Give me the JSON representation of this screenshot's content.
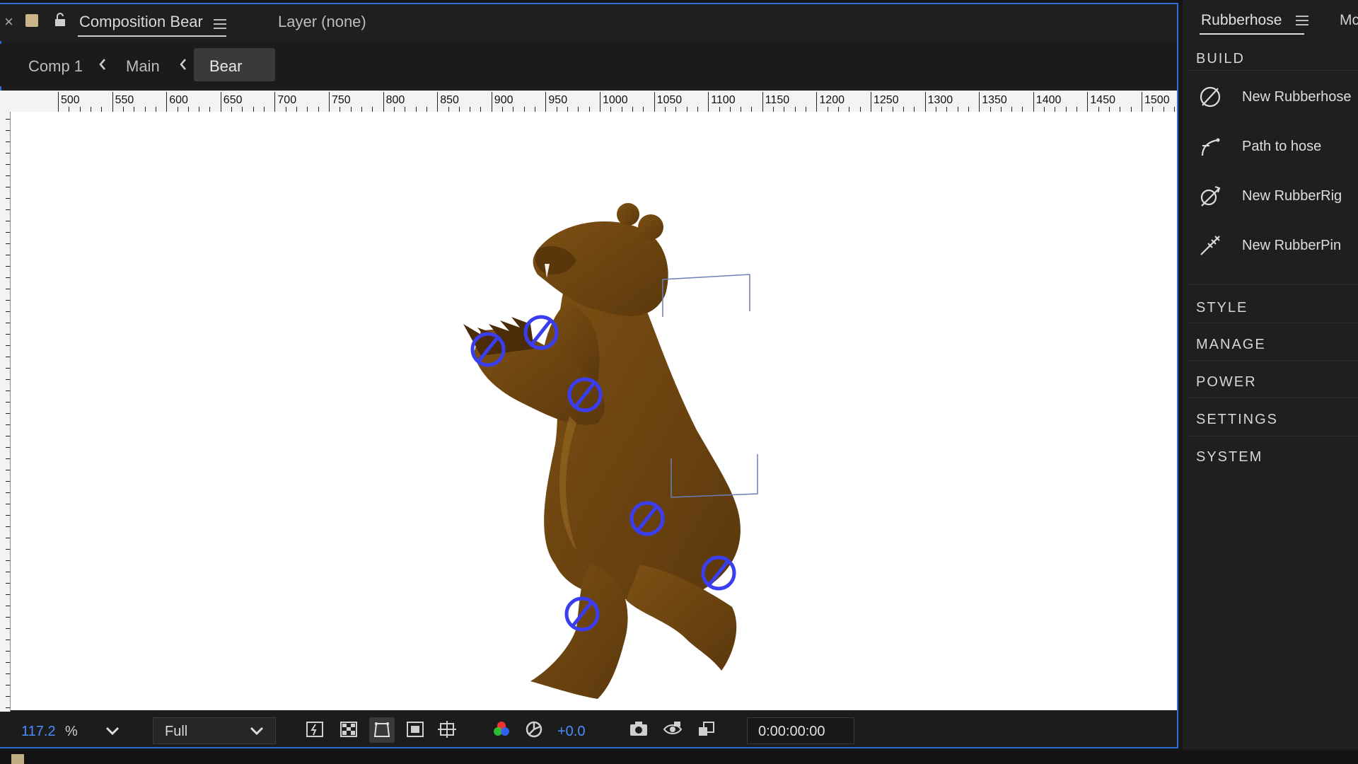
{
  "tabs": {
    "close_glyph": "×",
    "composition_tab": "Composition Bear",
    "layer_tab": "Layer (none)"
  },
  "breadcrumbs": [
    "Comp 1",
    "Main",
    "Bear"
  ],
  "ruler": {
    "labels": [
      "500",
      "550",
      "600",
      "650",
      "700",
      "750",
      "800",
      "850",
      "900",
      "950",
      "1000",
      "1050",
      "1100",
      "1150",
      "1200",
      "1250",
      "1300",
      "1350",
      "1400",
      "1450",
      "1500"
    ]
  },
  "viewer": {
    "subject": "bear-character",
    "rig_handle_icon": "rubberhose-null-icon",
    "colors": {
      "fur": "#6e4510",
      "fur_light": "#8a5a1a",
      "handles": "#3b3ef0",
      "selection": "#5a6fb0"
    }
  },
  "bottom": {
    "zoom_value": "117.2",
    "zoom_unit": "%",
    "resolution": "Full",
    "exposure": "+0.0",
    "timecode": "0:00:00:00",
    "icons": [
      "fast-previews-icon",
      "transparency-grid-icon",
      "mask-visibility-icon",
      "region-of-interest-icon",
      "guides-icon",
      "channel-icon",
      "color-management-icon",
      "snapshot-icon",
      "show-snapshot-icon",
      "draft-3d-icon"
    ]
  },
  "right_panel": {
    "tab_label": "Rubberhose",
    "next_tab_label": "Mc",
    "build_heading": "BUILD",
    "tools": [
      {
        "label": "New Rubberhose",
        "icon": "rubberhose-icon"
      },
      {
        "label": "Path to hose",
        "icon": "path-to-hose-icon"
      },
      {
        "label": "New RubberRig",
        "icon": "rubberrig-icon"
      },
      {
        "label": "New RubberPin",
        "icon": "rubberpin-icon"
      }
    ],
    "sections": [
      "STYLE",
      "MANAGE",
      "POWER",
      "SETTINGS",
      "SYSTEM"
    ]
  }
}
